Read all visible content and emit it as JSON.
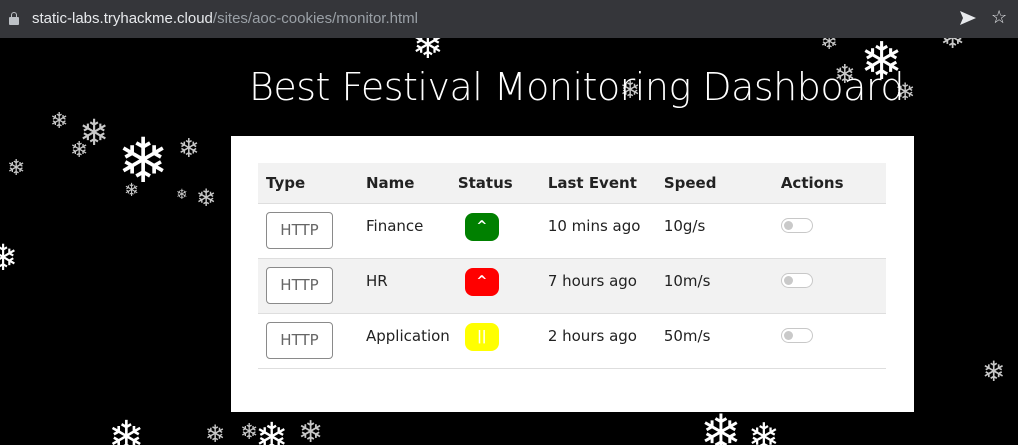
{
  "browser": {
    "url_host": "static-labs.tryhackme.cloud",
    "url_path": "/sites/aoc-cookies/monitor.html",
    "icons": [
      "lock-icon",
      "send-icon",
      "star-icon"
    ]
  },
  "page": {
    "title": "Best Festival Monitoring Dashboard"
  },
  "table": {
    "headers": {
      "type": "Type",
      "name": "Name",
      "status": "Status",
      "last_event": "Last Event",
      "speed": "Speed",
      "actions": "Actions"
    },
    "rows": [
      {
        "type": "HTTP",
        "name": "Finance",
        "status_symbol": "^",
        "status_color": "#008000",
        "last_event": "10 mins ago",
        "speed": "10g/s",
        "toggle_on": false
      },
      {
        "type": "HTTP",
        "name": "HR",
        "status_symbol": "^",
        "status_color": "#ff0000",
        "last_event": "7 hours ago",
        "speed": "10m/s",
        "toggle_on": false
      },
      {
        "type": "HTTP",
        "name": "Application",
        "status_symbol": "||",
        "status_color": "#ffff00",
        "last_event": "2 hours ago",
        "speed": "50m/s",
        "toggle_on": false
      }
    ]
  },
  "colors": {
    "background": "#000000",
    "panel": "#ffffff",
    "urlbar": "#35363a",
    "status_green": "#008000",
    "status_red": "#ff0000",
    "status_yellow": "#ffff00"
  }
}
